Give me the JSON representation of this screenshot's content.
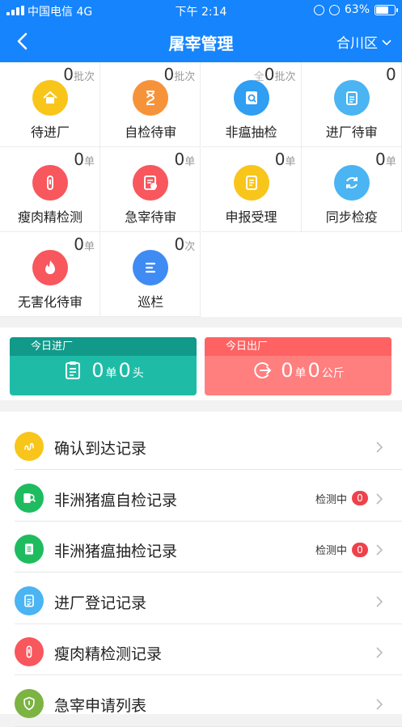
{
  "status_bar": {
    "carrier": "中国电信  4G",
    "time": "下午 2:14",
    "battery": "63%"
  },
  "navbar": {
    "title": "屠宰管理",
    "region": "合川区"
  },
  "grid": [
    {
      "name": "pending-entry",
      "label": "待进厂",
      "prefix": "",
      "count": "0",
      "unit": "批次",
      "color": "#f8c51b",
      "icon": "house-icon"
    },
    {
      "name": "self-test-review",
      "label": "自检待审",
      "prefix": "",
      "count": "0",
      "unit": "批次",
      "color": "#f6933a",
      "icon": "hourglass-icon"
    },
    {
      "name": "non-plague-sample",
      "label": "非瘟抽检",
      "prefix": "全",
      "count": "0",
      "unit": "批次",
      "color": "#2f9ef3",
      "icon": "magnifier-doc-icon"
    },
    {
      "name": "entry-review",
      "label": "进厂待审",
      "prefix": "",
      "count": "0",
      "unit": "",
      "color": "#4bb4f2",
      "icon": "clipboard-icon"
    },
    {
      "name": "clenbuterol-test",
      "label": "瘦肉精检测",
      "prefix": "",
      "count": "0",
      "unit": "单",
      "color": "#f7575d",
      "icon": "test-tube-icon"
    },
    {
      "name": "emergency-review",
      "label": "急宰待审",
      "prefix": "",
      "count": "0",
      "unit": "单",
      "color": "#f7575d",
      "icon": "doc-clock-icon"
    },
    {
      "name": "declaration-accept",
      "label": "申报受理",
      "prefix": "",
      "count": "0",
      "unit": "单",
      "color": "#f8c51b",
      "icon": "scroll-icon"
    },
    {
      "name": "sync-quarantine",
      "label": "同步检疫",
      "prefix": "",
      "count": "0",
      "unit": "单",
      "color": "#4bb4f2",
      "icon": "sync-icon"
    },
    {
      "name": "harmless-review",
      "label": "无害化待审",
      "prefix": "",
      "count": "0",
      "unit": "单",
      "color": "#f7575d",
      "icon": "flame-icon"
    },
    {
      "name": "pen-patrol",
      "label": "巡栏",
      "prefix": "",
      "count": "0",
      "unit": "次",
      "color": "#3f8bf4",
      "icon": "list-icon"
    }
  ],
  "today": {
    "in": {
      "title": "今日进厂",
      "count1": "0",
      "unit1": "单",
      "count2": "0",
      "unit2": "头"
    },
    "out": {
      "title": "今日出厂",
      "count1": "0",
      "unit1": "单",
      "count2": "0",
      "unit2": "公斤"
    }
  },
  "list": [
    {
      "name": "arrival-confirm-records",
      "label": "确认到达记录",
      "color": "#f8c51b",
      "icon": "route-icon",
      "status": "",
      "badge": ""
    },
    {
      "name": "asf-self-test-records",
      "label": "非洲猪瘟自检记录",
      "color": "#1ebc5f",
      "icon": "doc-search-icon",
      "status": "检测中",
      "badge": "0"
    },
    {
      "name": "asf-sample-test-records",
      "label": "非洲猪瘟抽检记录",
      "color": "#1ebc5f",
      "icon": "clipboard-list-icon",
      "status": "检测中",
      "badge": "0"
    },
    {
      "name": "entry-register-records",
      "label": "进厂登记记录",
      "color": "#4bb4f2",
      "icon": "clipboard-check-icon",
      "status": "",
      "badge": ""
    },
    {
      "name": "clenbuterol-records",
      "label": "瘦肉精检测记录",
      "color": "#f7575d",
      "icon": "test-tube-icon",
      "status": "",
      "badge": ""
    },
    {
      "name": "emergency-apply-list",
      "label": "急宰申请列表",
      "color": "#7cb342",
      "icon": "shield-icon",
      "status": "",
      "badge": ""
    }
  ]
}
